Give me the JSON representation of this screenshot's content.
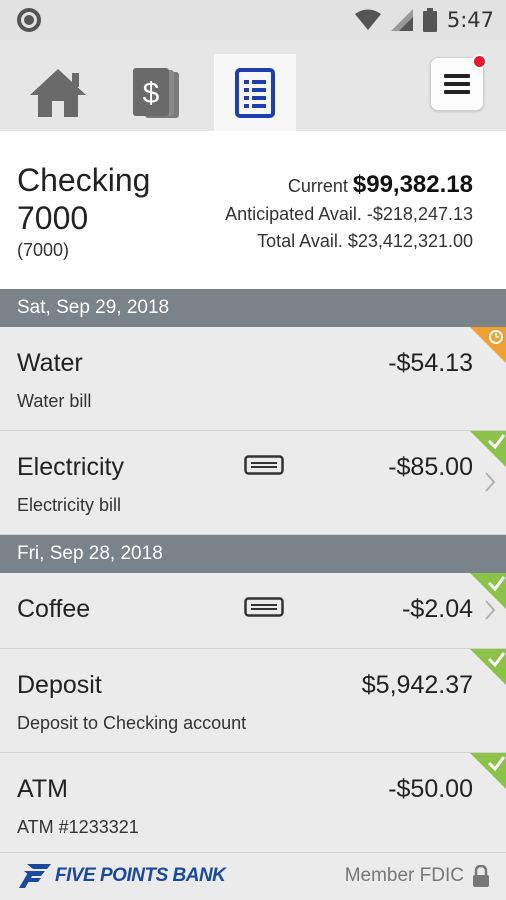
{
  "status_bar": {
    "time": "5:47"
  },
  "nav": {
    "tabs": [
      {
        "name": "home",
        "icon": "home-icon"
      },
      {
        "name": "transfers",
        "icon": "money-icon"
      },
      {
        "name": "transactions",
        "icon": "document-list-icon",
        "active": true
      }
    ],
    "menu_icon": "hamburger-icon",
    "notification": true
  },
  "account": {
    "name": "Checking 7000",
    "number": "(7000)",
    "current_label": "Current",
    "current_value": "$99,382.18",
    "anticipated": "Anticipated Avail. -$218,247.13",
    "total": "Total Avail. $23,412,321.00"
  },
  "groups": [
    {
      "date": "Sat, Sep 29, 2018"
    },
    {
      "date": "Fri, Sep 28, 2018"
    }
  ],
  "transactions": [
    {
      "name": "Water",
      "desc": "Water bill",
      "amount": "-$54.13",
      "status": "pending"
    },
    {
      "name": "Electricity",
      "desc": "Electricity bill",
      "amount": "-$85.00",
      "status": "cleared",
      "card": true
    },
    {
      "name": "Coffee",
      "amount": "-$2.04",
      "status": "cleared",
      "card": true
    },
    {
      "name": "Deposit",
      "desc": "Deposit to Checking account",
      "amount": "$5,942.37",
      "status": "cleared"
    },
    {
      "name": "ATM",
      "desc": "ATM #1233321",
      "amount": "-$50.00",
      "status": "cleared"
    }
  ],
  "footer": {
    "brand": "FIVE POINTS BANK",
    "fdic": "Member FDIC"
  },
  "colors": {
    "brand_blue": "#1b4a9c",
    "date_header": "#7a828a",
    "cleared_green": "#8bc34a",
    "pending_orange": "#f0a030",
    "badge_red": "#e8192c"
  }
}
